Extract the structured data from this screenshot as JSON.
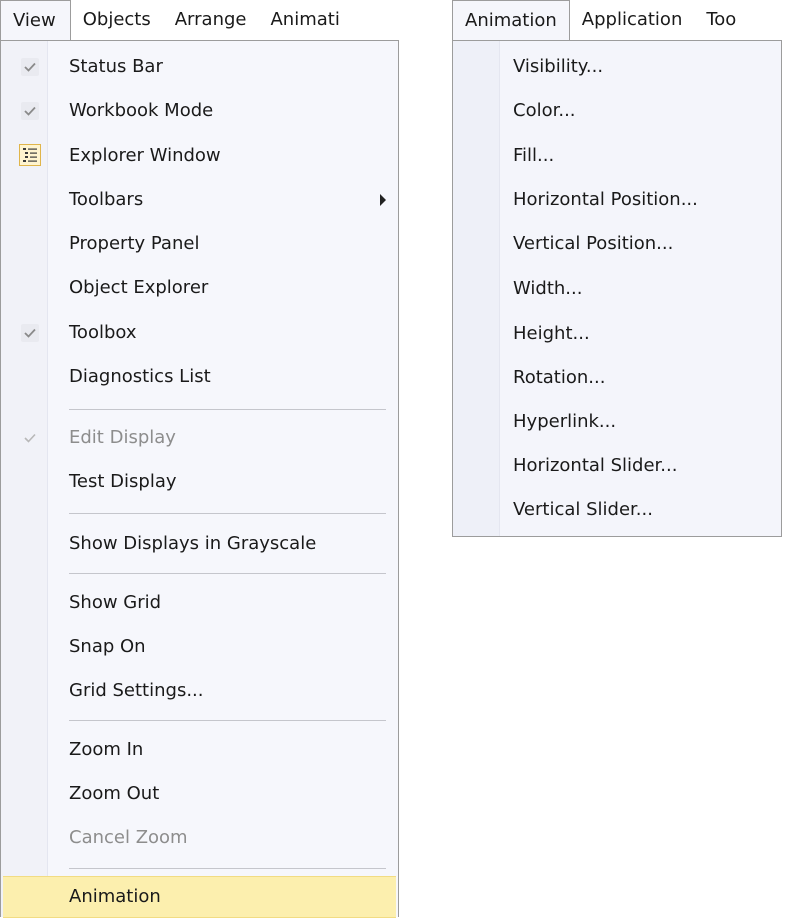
{
  "left_menubar": {
    "items": [
      "View",
      "Objects",
      "Arrange",
      "Animati"
    ],
    "open_item": "View"
  },
  "right_menubar": {
    "items": [
      "Animation",
      "Application",
      "Too"
    ],
    "open_item": "Animation"
  },
  "view_menu": {
    "items": [
      {
        "label": "Status Bar",
        "checked": true
      },
      {
        "label": "Workbook Mode",
        "checked": true
      },
      {
        "label": "Explorer Window",
        "icon": "explorer-window-icon"
      },
      {
        "label": "Toolbars",
        "submenu": true
      },
      {
        "label": "Property Panel"
      },
      {
        "label": "Object Explorer"
      },
      {
        "label": "Toolbox",
        "checked": true
      },
      {
        "label": "Diagnostics List"
      },
      {
        "label": "Edit Display",
        "checked": true,
        "disabled": true
      },
      {
        "label": "Test Display"
      },
      {
        "label": "Show Displays in Grayscale"
      },
      {
        "label": "Show Grid"
      },
      {
        "label": "Snap On"
      },
      {
        "label": "Grid Settings..."
      },
      {
        "label": "Zoom In"
      },
      {
        "label": "Zoom Out"
      },
      {
        "label": "Cancel Zoom",
        "disabled": true
      },
      {
        "label": "Animation",
        "highlighted": true
      }
    ]
  },
  "animation_menu": {
    "items": [
      "Visibility...",
      "Color...",
      "Fill...",
      "Horizontal Position...",
      "Vertical Position...",
      "Width...",
      "Height...",
      "Rotation...",
      "Hyperlink...",
      "Horizontal Slider...",
      "Vertical Slider..."
    ]
  },
  "colors": {
    "highlight": "#fcefae",
    "menu_background": "#f6f7fc",
    "border": "#9c9c9c",
    "disabled_text": "#8d8d8d"
  }
}
